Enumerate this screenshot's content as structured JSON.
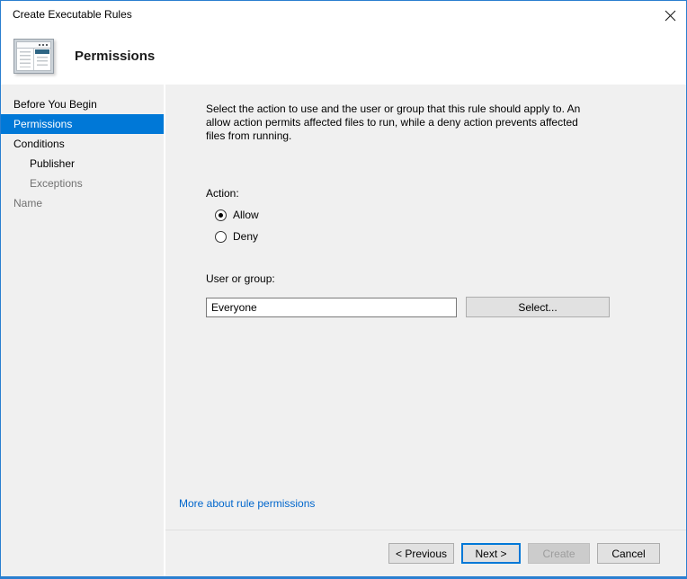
{
  "window": {
    "title": "Create Executable Rules"
  },
  "header": {
    "title": "Permissions"
  },
  "sidebar": {
    "items": [
      {
        "label": "Before You Begin",
        "state": ""
      },
      {
        "label": "Permissions",
        "state": "selected"
      },
      {
        "label": "Conditions",
        "state": ""
      },
      {
        "label": "Publisher",
        "state": "indent"
      },
      {
        "label": "Exceptions",
        "state": "indent disabled"
      },
      {
        "label": "Name",
        "state": "disabled"
      }
    ]
  },
  "content": {
    "description": "Select the action to use and the user or group that this rule should apply to. An allow action permits affected files to run, while a deny action prevents affected files from running.",
    "action": {
      "label": "Action:",
      "options": [
        {
          "label": "Allow",
          "state": "checked"
        },
        {
          "label": "Deny",
          "state": ""
        }
      ]
    },
    "user_group": {
      "label": "User or group:",
      "value": "Everyone",
      "select_button": "Select..."
    },
    "link": "More about rule permissions"
  },
  "footer": {
    "buttons": [
      {
        "label": "< Previous",
        "state": ""
      },
      {
        "label": "Next >",
        "state": "focused"
      },
      {
        "label": "Create",
        "state": "disabled"
      },
      {
        "label": "Cancel",
        "state": ""
      }
    ]
  },
  "icons": {
    "close": "close-icon",
    "wizard": "wizard-window-icon"
  },
  "colors": {
    "accent": "#0078d7",
    "selected_step_bg": "#0078d7",
    "link": "#0066cc",
    "body_bg": "#f0f0f0",
    "window_border": "#2a7fd0",
    "disabled_text": "#9d9d9d"
  }
}
